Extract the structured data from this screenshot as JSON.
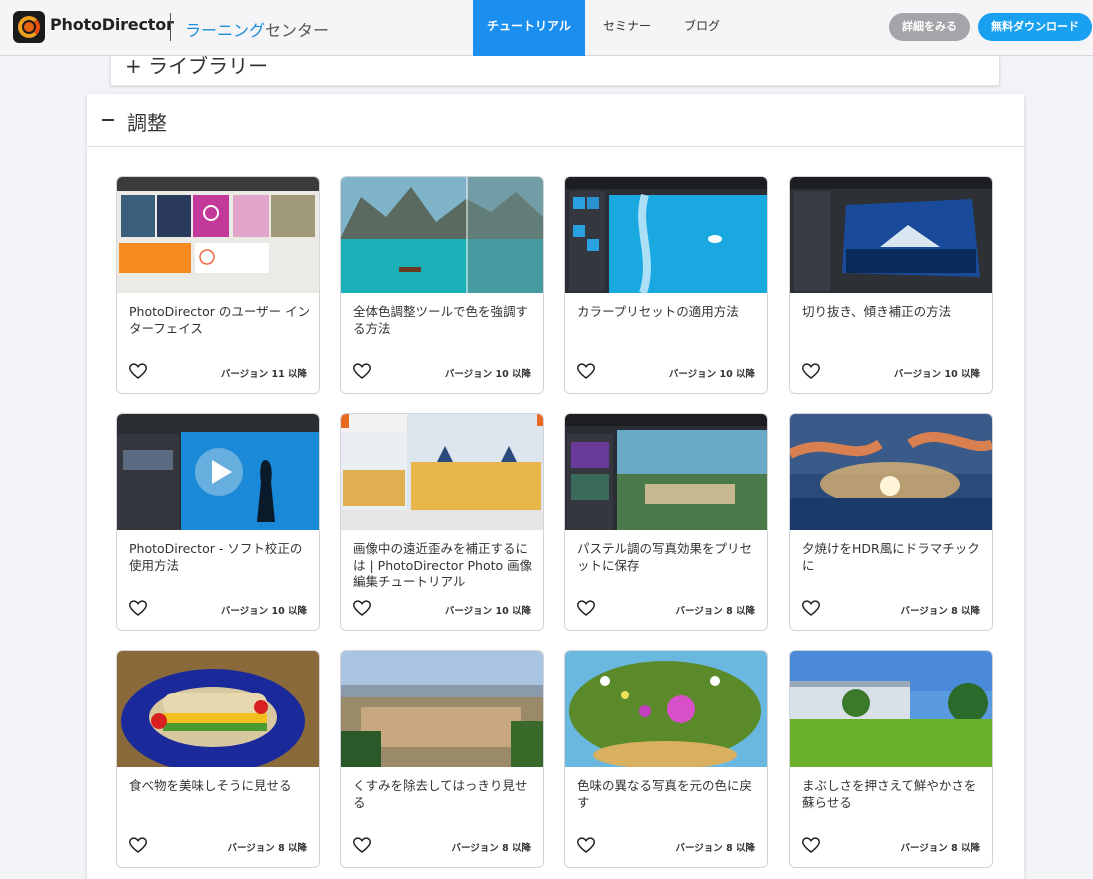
{
  "header": {
    "brand": "PhotoDirector",
    "learning_blue": "ラーニング",
    "learning_rest": "センター",
    "nav": [
      {
        "label": "チュートリアル",
        "active": true
      },
      {
        "label": "セミナー",
        "active": false
      },
      {
        "label": "ブログ",
        "active": false
      }
    ],
    "details_button": "詳細をみる",
    "download_button": "無料ダウンロード"
  },
  "library_section": {
    "label": "+ ライブラリー"
  },
  "adjust_section": {
    "title": "調整"
  },
  "cards": [
    {
      "title": "PhotoDirector のユーザー インターフェイス",
      "version": "バージョン 11 以降",
      "thumb": "ui-icon"
    },
    {
      "title": "全体色調整ツールで色を強調する方法",
      "version": "バージョン 10 以降",
      "thumb": "lake-icon"
    },
    {
      "title": "カラープリセットの適用方法",
      "version": "バージョン 10 以降",
      "thumb": "ocean-icon"
    },
    {
      "title": "切り抜き、傾き補正の方法",
      "version": "バージョン 10 以降",
      "thumb": "fuji-icon"
    },
    {
      "title": "PhotoDirector - ソフト校正の使用方法",
      "version": "バージョン 10 以降",
      "thumb": "aquarium-icon"
    },
    {
      "title": "画像中の遠近歪みを補正するには | PhotoDirector Photo 画像編集チュートリアル",
      "version": "バージョン 10 以降",
      "thumb": "castle-icon"
    },
    {
      "title": "パステル調の写真効果をプリセットに保存",
      "version": "バージョン 8 以降",
      "thumb": "town-icon"
    },
    {
      "title": "夕焼けをHDR風にドラマチックに",
      "version": "バージョン 8 以降",
      "thumb": "sunset-icon"
    },
    {
      "title": "食べ物を美味しそうに見せる",
      "version": "バージョン 8 以降",
      "thumb": "sandwich-icon"
    },
    {
      "title": "くすみを除去してはっきり見せる",
      "version": "バージョン 8 以降",
      "thumb": "city-icon"
    },
    {
      "title": "色味の異なる写真を元の色に戻す",
      "version": "バージョン 8 以降",
      "thumb": "flowers-icon"
    },
    {
      "title": "まぶしさを押さえて鮮やかさを蘇らせる",
      "version": "バージョン 8 以降",
      "thumb": "lawn-icon"
    }
  ]
}
